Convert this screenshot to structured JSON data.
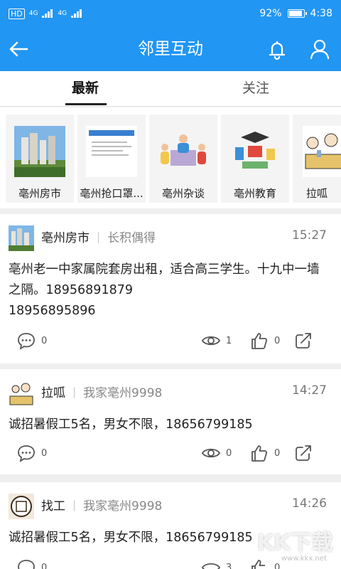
{
  "status": {
    "network_left": "HD",
    "signal_a": "4G",
    "signal_b": "4G",
    "battery": "92%",
    "time": "4:38"
  },
  "header": {
    "title": "邻里互动"
  },
  "tabs": [
    {
      "label": "最新"
    },
    {
      "label": "关注"
    }
  ],
  "circles": [
    {
      "label": "亳州房市",
      "icon": "city-buildings-image"
    },
    {
      "label": "亳州抢口罩...",
      "icon": "document-image"
    },
    {
      "label": "亳州杂谈",
      "icon": "meeting-people-image"
    },
    {
      "label": "亳州教育",
      "icon": "education-image"
    },
    {
      "label": "拉呱",
      "icon": "chat-people-image"
    }
  ],
  "posts": [
    {
      "source": "亳州房市",
      "author": "长积偶得",
      "time": "15:27",
      "text_line1": "亳州老一中家属院套房出租，适合高三学生。十九中一墙之隔。18956891879",
      "text_line2": "18956895896",
      "comments": "0",
      "views": "1",
      "likes": "0"
    },
    {
      "source": "拉呱",
      "author": "我家亳州9998",
      "time": "14:27",
      "text_line1": "诚招暑假工5名，男女不限，18656799185",
      "text_line2": "",
      "comments": "0",
      "views": "0",
      "likes": "0"
    },
    {
      "source": "找工",
      "author": "我家亳州9998",
      "time": "14:26",
      "text_line1": "诚招暑假工5名，男女不限，18656799185",
      "text_line2": "",
      "comments": "0",
      "views": "3",
      "likes": "0"
    }
  ],
  "watermark": {
    "text": "KK下载",
    "sub": "www.kkx.net"
  },
  "colors": {
    "primary": "#2196f3"
  }
}
